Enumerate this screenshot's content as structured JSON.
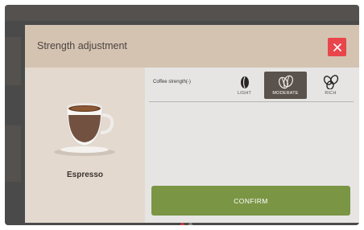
{
  "dialog": {
    "title": "Strength adjustment",
    "close_icon": "close-icon"
  },
  "product": {
    "name": "Espresso",
    "image_icon": "espresso-cup-icon"
  },
  "strength": {
    "label": "Coffee strength(-)",
    "options": [
      {
        "label": "LIGHT",
        "icon": "single-bean-icon",
        "selected": false
      },
      {
        "label": "MODERATE",
        "icon": "double-bean-icon",
        "selected": true
      },
      {
        "label": "RICH",
        "icon": "triple-bean-icon",
        "selected": false
      }
    ]
  },
  "confirm": {
    "label": "CONFIRM"
  },
  "pagination": {
    "pages": 2,
    "current": 1
  },
  "colors": {
    "header": "#d5c3b1",
    "close": "#e8464b",
    "confirm": "#7a9544",
    "selected": "#5a524c"
  }
}
